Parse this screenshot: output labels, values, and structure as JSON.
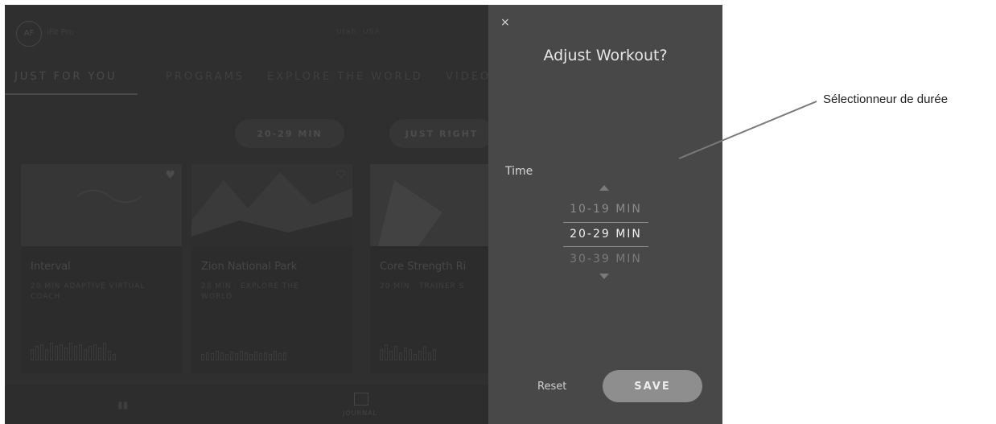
{
  "app": {
    "logo_initials": "AF",
    "logo_text": "iFit Pro",
    "location": "Utah, USA",
    "tabs": [
      "JUST FOR YOU",
      "PROGRAMS",
      "EXPLORE THE WORLD",
      "VIDEO"
    ],
    "active_tab": "JUST FOR YOU",
    "filters": [
      "20-29 MIN",
      "JUST RIGHT"
    ],
    "cards": [
      {
        "title": "Interval",
        "subtitle": "20 MIN ADAPTIVE VIRTUAL COACH"
      },
      {
        "title": "Zion National Park",
        "subtitle": "28 MIN · EXPLORE THE WORLD"
      },
      {
        "title": "Core Strength Ri",
        "subtitle": "20 MIN · TRAINER S"
      }
    ],
    "bottom_nav": {
      "journal_label": "JOURNAL"
    }
  },
  "modal": {
    "close_glyph": "×",
    "title": "Adjust Workout?",
    "time_label": "Time",
    "options": [
      "10-19 MIN",
      "20-29 MIN",
      "30-39 MIN"
    ],
    "selected_option": "20-29 MIN",
    "reset_label": "Reset",
    "save_label": "SAVE"
  },
  "annotation": {
    "label": "Sélectionneur de durée"
  },
  "colors": {
    "overlay_bg": "#2f2f2f",
    "panel_bg": "#484848",
    "save_button": "#8e8e8e"
  },
  "icons": [
    "heart-icon",
    "close-icon",
    "up-arrow-icon",
    "down-arrow-icon",
    "journal-icon"
  ]
}
